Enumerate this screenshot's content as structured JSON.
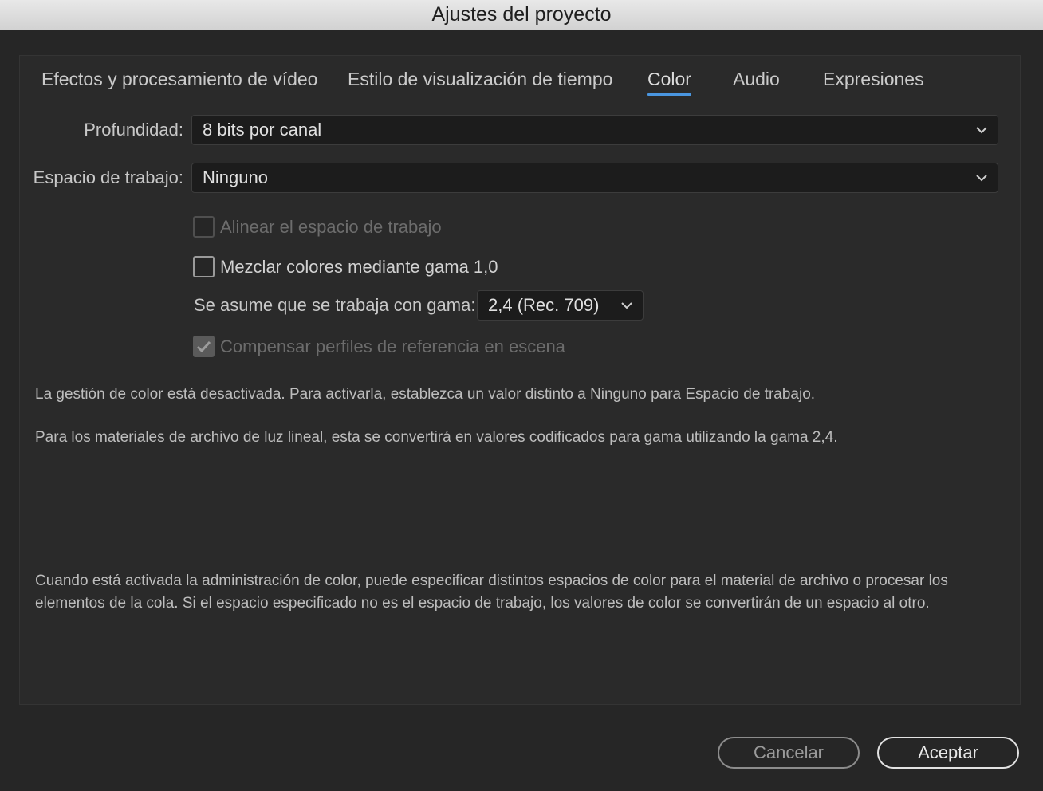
{
  "window": {
    "title": "Ajustes del proyecto"
  },
  "tabs": [
    {
      "label": "Efectos y procesamiento de vídeo",
      "active": false
    },
    {
      "label": "Estilo de visualización de tiempo",
      "active": false
    },
    {
      "label": "Color",
      "active": true
    },
    {
      "label": "Audio",
      "active": false
    },
    {
      "label": "Expresiones",
      "active": false
    }
  ],
  "form": {
    "depth": {
      "label": "Profundidad:",
      "value": "8 bits por canal"
    },
    "workspace": {
      "label": "Espacio de trabajo:",
      "value": "Ninguno"
    },
    "align_workspace": {
      "label": "Alinear el espacio de trabajo",
      "checked": false,
      "enabled": false
    },
    "blend_gamma": {
      "label": "Mezclar colores mediante gama 1,0",
      "checked": false,
      "enabled": true
    },
    "assumed_gamma": {
      "label": "Se asume que se trabaja con gama:",
      "value": "2,4 (Rec. 709)"
    },
    "compensate_profiles": {
      "label": "Compensar perfiles de referencia en escena",
      "checked": true,
      "enabled": false
    }
  },
  "info": {
    "line1": "La gestión de color está desactivada. Para activarla, establezca un valor distinto a Ninguno para Espacio de trabajo.",
    "line2": "Para los materiales de archivo de luz lineal, esta se convertirá en valores codificados para gama utilizando la gama 2,4.",
    "line3": "Cuando está activada la administración de color, puede especificar distintos espacios de color para el material de archivo o procesar los elementos de la cola. Si el espacio especificado no es el espacio de trabajo, los valores de color se convertirán de un espacio al otro."
  },
  "buttons": {
    "cancel": "Cancelar",
    "ok": "Aceptar"
  },
  "colors": {
    "accent": "#4a96e0",
    "background": "#262626",
    "titlebar": "#dcdcdc"
  },
  "icons": {
    "dropdown": "chevron-down-icon",
    "check": "check-icon"
  }
}
